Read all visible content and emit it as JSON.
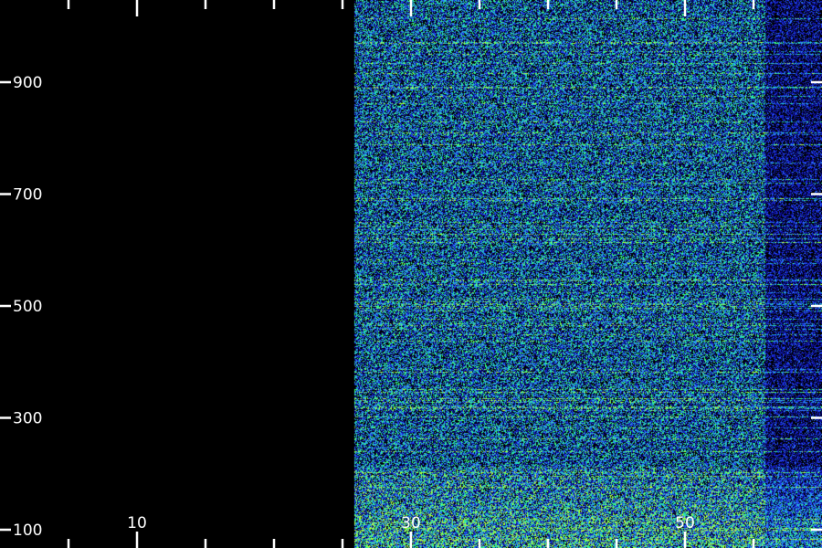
{
  "chart_data": {
    "type": "heatmap",
    "title": "",
    "xlabel": "",
    "ylabel": "",
    "x_ticks": [
      10,
      30,
      50
    ],
    "y_ticks": [
      100,
      300,
      500,
      700,
      900
    ],
    "data_columns": {
      "start": 26,
      "end": 58,
      "dimmer_from": 56
    },
    "rows": {
      "min": 100,
      "max": 1000
    },
    "colormap": [
      "#000000",
      "#0b0b8a",
      "#1a2ee0",
      "#2f7bff",
      "#1fd6c8",
      "#3bff7a",
      "#b6ff3a"
    ],
    "grid": false,
    "legend": "none"
  }
}
